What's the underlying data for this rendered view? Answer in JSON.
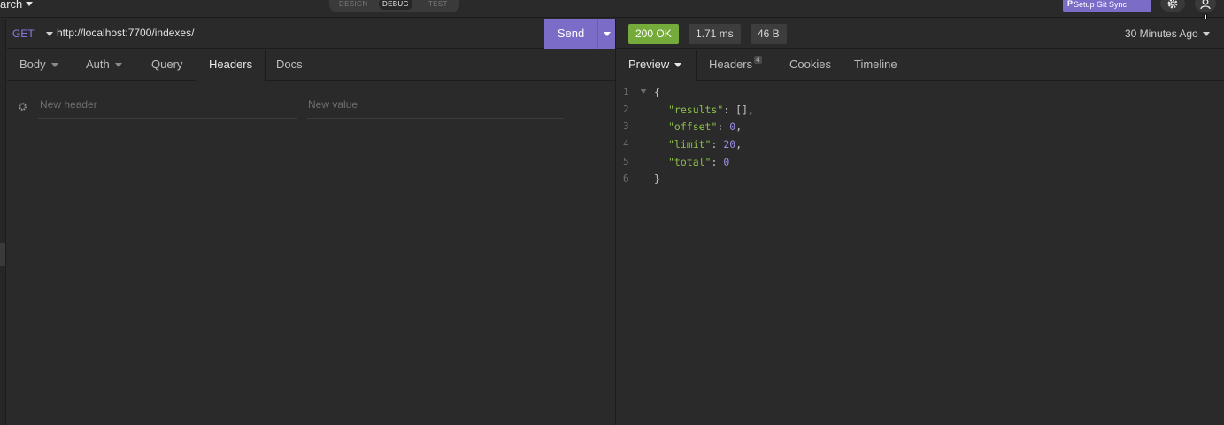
{
  "workspace": {
    "name": "arch"
  },
  "modes": [
    {
      "label": "DESIGN",
      "active": false
    },
    {
      "label": "DEBUG",
      "active": true
    },
    {
      "label": "TEST",
      "active": false
    }
  ],
  "git_sync": {
    "label": "Setup Git Sync"
  },
  "request": {
    "method": "GET",
    "url": "http://localhost:7700/indexes/",
    "send_label": "Send",
    "tabs": [
      {
        "label": "Body",
        "dropdown": true
      },
      {
        "label": "Auth",
        "dropdown": true
      },
      {
        "label": "Query",
        "dropdown": false
      },
      {
        "label": "Headers",
        "dropdown": false,
        "active": true
      },
      {
        "label": "Docs",
        "dropdown": false
      }
    ],
    "headers_row": {
      "name_placeholder": "New header",
      "value_placeholder": "New value"
    }
  },
  "response": {
    "status": "200 OK",
    "time": "1.71 ms",
    "size": "46 B",
    "history": "30 Minutes Ago",
    "tabs": [
      {
        "label": "Preview",
        "active": true,
        "dropdown": true
      },
      {
        "label": "Headers",
        "count": "4"
      },
      {
        "label": "Cookies"
      },
      {
        "label": "Timeline"
      }
    ],
    "body_lines": [
      {
        "n": "1",
        "text": "{"
      },
      {
        "n": "2",
        "key": "\"results\"",
        "value": "[]",
        "comma": ","
      },
      {
        "n": "3",
        "key": "\"offset\"",
        "value": "0",
        "comma": ","
      },
      {
        "n": "4",
        "key": "\"limit\"",
        "value": "20",
        "comma": ","
      },
      {
        "n": "5",
        "key": "\"total\"",
        "value": "0",
        "comma": ""
      },
      {
        "n": "6",
        "text": "}"
      }
    ]
  },
  "colors": {
    "accent": "#7b6cc8",
    "ok": "#75ab3a",
    "json_key": "#8bbf4a",
    "json_number": "#9c8ee8"
  },
  "icons": [
    "chevron-down-icon",
    "gear-icon",
    "account-icon",
    "cursor-hand-icon",
    "git-icon",
    "fold-arrow-icon"
  ]
}
